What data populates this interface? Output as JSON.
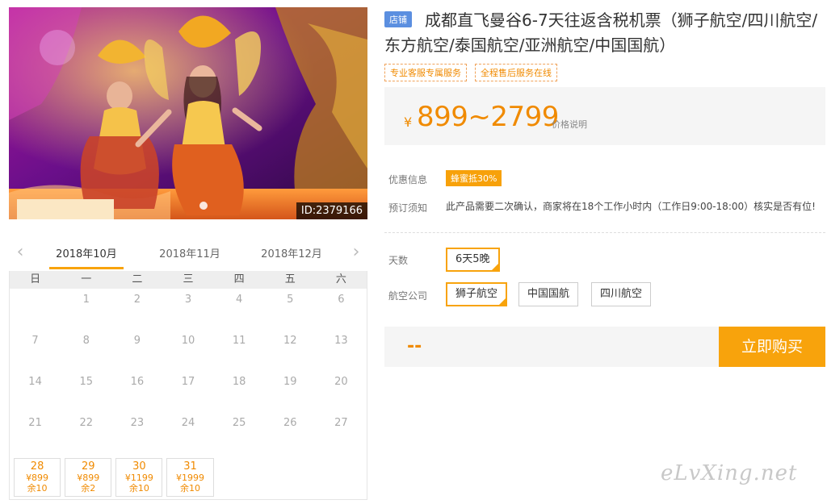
{
  "hero": {
    "id_label": "ID:2379166"
  },
  "calendar": {
    "months": [
      "2018年10月",
      "2018年11月",
      "2018年12月"
    ],
    "active_month": 0,
    "weekdays": [
      "日",
      "一",
      "二",
      "三",
      "四",
      "五",
      "六"
    ],
    "rows": [
      [
        null,
        "1",
        "2",
        "3",
        "4",
        "5",
        "6"
      ],
      [
        "7",
        "8",
        "9",
        "10",
        "11",
        "12",
        "13"
      ],
      [
        "14",
        "15",
        "16",
        "17",
        "18",
        "19",
        "20"
      ],
      [
        "21",
        "22",
        "23",
        "24",
        "25",
        "26",
        "27"
      ]
    ],
    "available_days": [
      {
        "day": "28",
        "price": "¥899",
        "remain": "余10"
      },
      {
        "day": "29",
        "price": "¥899",
        "remain": "余2"
      },
      {
        "day": "30",
        "price": "¥1199",
        "remain": "余10"
      },
      {
        "day": "31",
        "price": "¥1999",
        "remain": "余10"
      }
    ]
  },
  "product": {
    "shop_tag": "店铺",
    "title": "成都直飞曼谷6-7天往返含税机票（狮子航空/四川航空/东方航空/泰国航空/亚洲航空/中国国航）",
    "service_tags": [
      "专业客服专属服务",
      "全程售后服务在线"
    ],
    "price_symbol": "¥",
    "price_range": "899~2799",
    "price_note": "价格说明",
    "promo_label": "优惠信息",
    "promo_badge": "蜂蜜抵30%",
    "notice_label": "预订须知",
    "notice_text": "此产品需要二次确认，商家将在18个工作小时内（工作日9:00-18:00）核实是否有位!",
    "days_label": "天数",
    "days_options": [
      "6天5晚"
    ],
    "airline_label": "航空公司",
    "airline_options": [
      "狮子航空",
      "中国国航",
      "四川航空"
    ],
    "selected_airline": "狮子航空",
    "total": "--",
    "buy_label": "立即购买"
  },
  "watermark": "eLvXing.net",
  "colors": {
    "accent": "#f8a30c",
    "price": "#f08a00",
    "tag_blue": "#5b8fe0"
  }
}
